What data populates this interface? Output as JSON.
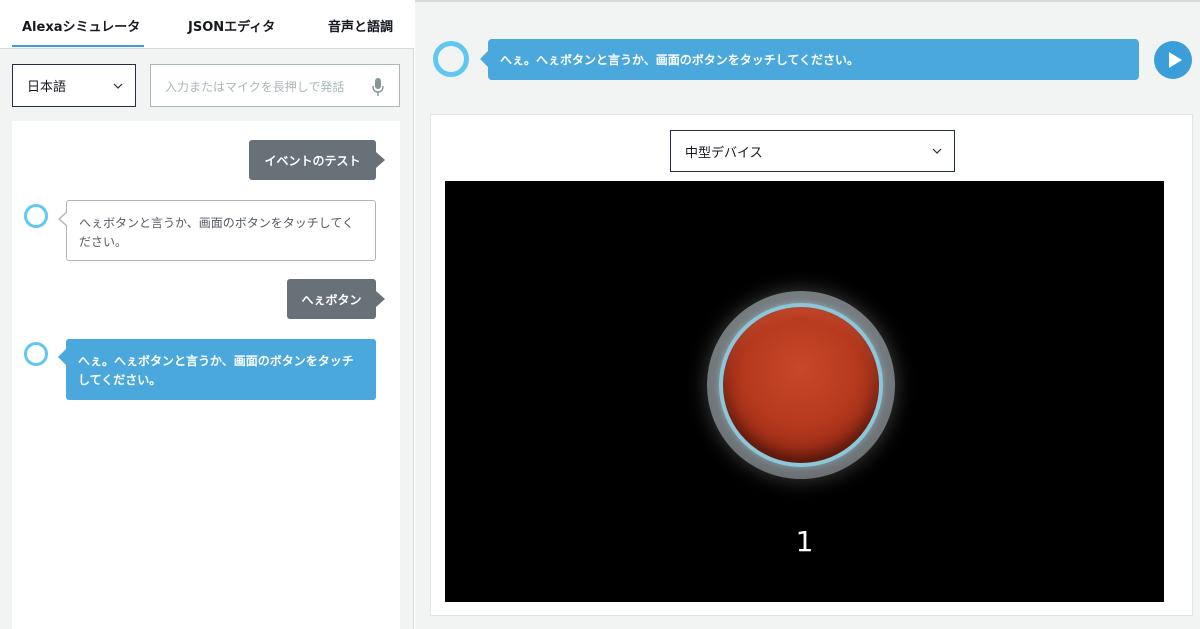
{
  "tabs": [
    {
      "label": "Alexaシミュレータ"
    },
    {
      "label": "JSONエディタ"
    },
    {
      "label": "音声と語調"
    }
  ],
  "language": {
    "selected": "日本語"
  },
  "utterance": {
    "placeholder": "入力またはマイクを長押しで発話"
  },
  "chat": {
    "messages": [
      {
        "from": "user",
        "text": "イベントのテスト"
      },
      {
        "from": "alexa",
        "text": "へぇボタンと言うか、画面のボタンをタッチしてください。"
      },
      {
        "from": "user",
        "text": "へぇボタン"
      },
      {
        "from": "alexa",
        "text": "へぇ。へぇボタンと言うか、画面のボタンをタッチしてください。"
      }
    ]
  },
  "response": {
    "text": "へぇ。へぇボタンと言うか、画面のボタンをタッチしてください。"
  },
  "device": {
    "selected": "中型デバイス"
  },
  "display": {
    "count": "1"
  },
  "colors": {
    "accent": "#3b9ed9",
    "alexa_bubble": "#4aa8dc",
    "user_bubble": "#687078",
    "alexa_ring": "#5fc7f0",
    "button_red": "#b73a1e"
  },
  "icons": {
    "language_dropdown": "chevron-down-icon",
    "mic": "microphone-icon",
    "play": "play-icon",
    "alexa": "alexa-ring-icon"
  }
}
